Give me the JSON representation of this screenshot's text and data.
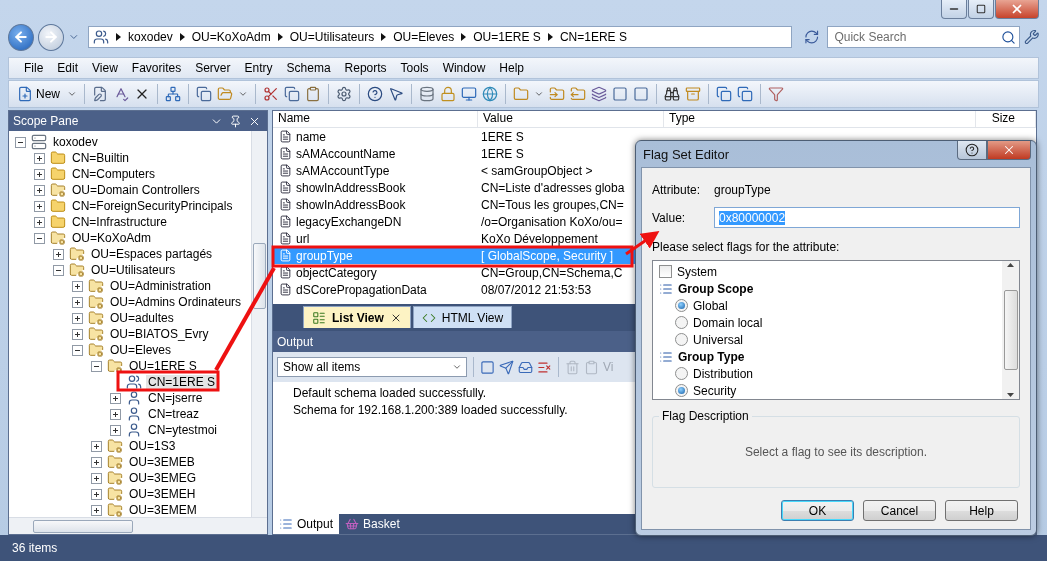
{
  "address_bar": {
    "crumbs": [
      "koxodev",
      "OU=KoXoAdm",
      "OU=Utilisateurs",
      "OU=Eleves",
      "OU=1ERE S",
      "CN=1ERE S"
    ]
  },
  "search": {
    "placeholder": "Quick Search"
  },
  "menu": [
    "File",
    "Edit",
    "View",
    "Favorites",
    "Server",
    "Entry",
    "Schema",
    "Reports",
    "Tools",
    "Window",
    "Help"
  ],
  "toolbar": {
    "new_button": "New"
  },
  "scope_pane": {
    "title": "Scope Pane",
    "tree": [
      {
        "label": "koxodev",
        "kind": "server",
        "expanded": true,
        "selected": false,
        "children": [
          {
            "label": "CN=Builtin",
            "kind": "folder",
            "expanded": false,
            "selected": false
          },
          {
            "label": "CN=Computers",
            "kind": "folder",
            "expanded": false,
            "selected": false
          },
          {
            "label": "OU=Domain Controllers",
            "kind": "ou",
            "expanded": false,
            "selected": false
          },
          {
            "label": "CN=ForeignSecurityPrincipals",
            "kind": "folder",
            "expanded": false,
            "selected": false
          },
          {
            "label": "CN=Infrastructure",
            "kind": "folder",
            "expanded": false,
            "selected": false
          },
          {
            "label": "OU=KoXoAdm",
            "kind": "ou",
            "expanded": true,
            "selected": false,
            "children": [
              {
                "label": "OU=Espaces partagés",
                "kind": "ou",
                "expanded": false,
                "selected": false
              },
              {
                "label": "OU=Utilisateurs",
                "kind": "ou",
                "expanded": true,
                "selected": false,
                "children": [
                  {
                    "label": "OU=Administration",
                    "kind": "ou",
                    "expanded": false,
                    "selected": false
                  },
                  {
                    "label": "OU=Admins Ordinateurs",
                    "kind": "ou",
                    "expanded": false,
                    "selected": false
                  },
                  {
                    "label": "OU=adultes",
                    "kind": "ou",
                    "expanded": false,
                    "selected": false
                  },
                  {
                    "label": "OU=BIATOS_Evry",
                    "kind": "ou",
                    "expanded": false,
                    "selected": false
                  },
                  {
                    "label": "OU=Eleves",
                    "kind": "ou",
                    "expanded": true,
                    "selected": false,
                    "children": [
                      {
                        "label": "OU=1ERE S",
                        "kind": "ou",
                        "expanded": true,
                        "selected": false,
                        "children": [
                          {
                            "label": "CN=1ERE S",
                            "kind": "group",
                            "selected": true
                          },
                          {
                            "label": "CN=jserre",
                            "kind": "user",
                            "expanded": false,
                            "selected": false
                          },
                          {
                            "label": "CN=treaz",
                            "kind": "user",
                            "expanded": false,
                            "selected": false
                          },
                          {
                            "label": "CN=ytestmoi",
                            "kind": "user",
                            "expanded": false,
                            "selected": false
                          }
                        ]
                      },
                      {
                        "label": "OU=1S3",
                        "kind": "ou",
                        "expanded": false,
                        "selected": false
                      },
                      {
                        "label": "OU=3EMEB",
                        "kind": "ou",
                        "expanded": false,
                        "selected": false
                      },
                      {
                        "label": "OU=3EMEG",
                        "kind": "ou",
                        "expanded": false,
                        "selected": false
                      },
                      {
                        "label": "OU=3EMEH",
                        "kind": "ou",
                        "expanded": false,
                        "selected": false
                      },
                      {
                        "label": "OU=3EMEM",
                        "kind": "ou",
                        "expanded": false,
                        "selected": false
                      }
                    ]
                  }
                ]
              }
            ]
          }
        ]
      }
    ]
  },
  "list_view": {
    "columns": [
      "Name",
      "Value",
      "Type",
      "Size"
    ],
    "rows": [
      {
        "name": "name",
        "value": "1ERE S",
        "selected": false
      },
      {
        "name": "sAMAccountName",
        "value": "1ERE S",
        "selected": false
      },
      {
        "name": "sAMAccountType",
        "value": "< samGroupObject >",
        "selected": false
      },
      {
        "name": "showInAddressBook",
        "value": "CN=Liste d'adresses globa",
        "selected": false
      },
      {
        "name": "showInAddressBook",
        "value": "CN=Tous les groupes,CN=",
        "selected": false
      },
      {
        "name": "legacyExchangeDN",
        "value": "/o=Organisation KoXo/ou=",
        "selected": false
      },
      {
        "name": "url",
        "value": "KoXo Développement",
        "selected": false
      },
      {
        "name": "groupType",
        "value": "[ GlobalScope, Security ]",
        "selected": true
      },
      {
        "name": "objectCategory",
        "value": "CN=Group,CN=Schema,C",
        "selected": false
      },
      {
        "name": "dSCorePropagationData",
        "value": "08/07/2012 21:53:53",
        "selected": false
      }
    ]
  },
  "view_tabs": [
    {
      "label": "List View",
      "selected": true
    },
    {
      "label": "HTML View",
      "selected": false
    }
  ],
  "output": {
    "title": "Output",
    "filter": "Show all items",
    "toolbar_text": "Vi",
    "lines": [
      "Default schema loaded successfully.",
      "Schema for 192.168.1.200:389 loaded successfully."
    ]
  },
  "bottom_tabs": [
    {
      "label": "Output",
      "selected": true
    },
    {
      "label": "Basket",
      "selected": false
    }
  ],
  "status_bar": {
    "count": "36 items"
  },
  "dialog": {
    "title": "Flag Set Editor",
    "attribute_label": "Attribute:",
    "attribute": "groupType",
    "value_label": "Value:",
    "value": "0x80000002",
    "prompt": "Please select flags for the attribute:",
    "flags": [
      {
        "kind": "checkbox",
        "label": "System",
        "checked": false
      },
      {
        "kind": "group",
        "label": "Group Scope"
      },
      {
        "kind": "radio",
        "label": "Global",
        "selected": true
      },
      {
        "kind": "radio",
        "label": "Domain local",
        "selected": false
      },
      {
        "kind": "radio",
        "label": "Universal",
        "selected": false
      },
      {
        "kind": "group",
        "label": "Group Type"
      },
      {
        "kind": "radio",
        "label": "Distribution",
        "selected": false
      },
      {
        "kind": "radio",
        "label": "Security",
        "selected": true
      }
    ],
    "description_title": "Flag Description",
    "description": "Select a flag to see its description.",
    "buttons": [
      {
        "label": "OK",
        "default": true
      },
      {
        "label": "Cancel",
        "default": false
      },
      {
        "label": "Help",
        "default": false
      }
    ]
  }
}
